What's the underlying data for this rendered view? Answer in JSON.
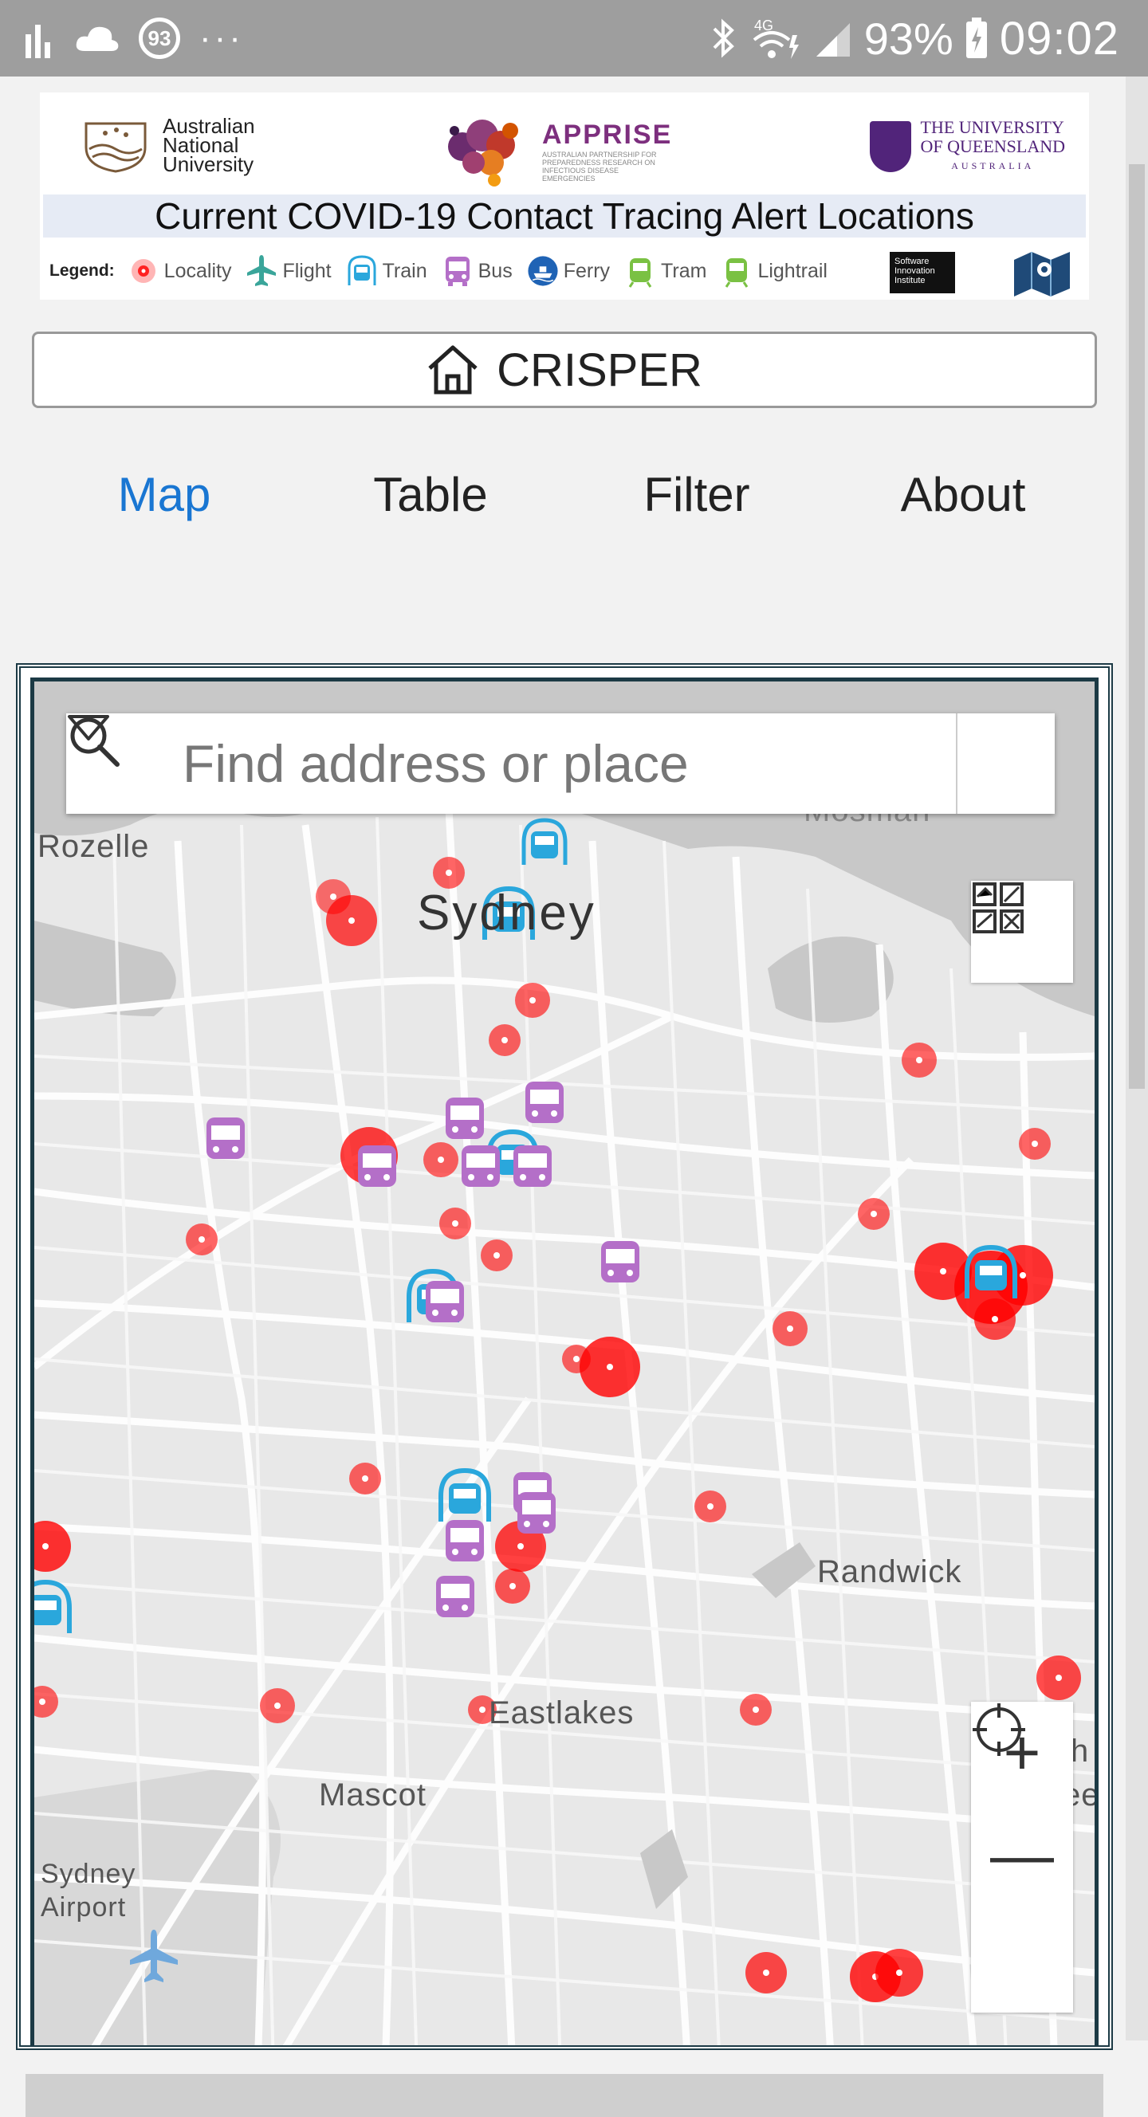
{
  "status_bar": {
    "notification_badge": "93",
    "more": "···",
    "battery": "93%",
    "time": "09:02",
    "network": "4G"
  },
  "banner": {
    "anu_name": "Australian National University",
    "apprise_name": "APPRISE",
    "apprise_subtitle": "AUSTRALIAN PARTNERSHIP FOR PREPAREDNESS RESEARCH ON INFECTIOUS DISEASE EMERGENCIES",
    "uq_name_line1": "THE UNIVERSITY",
    "uq_name_line2": "OF QUEENSLAND",
    "uq_country": "AUSTRALIA",
    "title": "Current COVID-19 Contact Tracing Alert Locations",
    "legend_label": "Legend:",
    "legend": [
      "Locality",
      "Flight",
      "Train",
      "Bus",
      "Ferry",
      "Tram",
      "Lightrail"
    ],
    "sii_text": "Software Innovation Institute"
  },
  "home": {
    "label": "CRISPER"
  },
  "tabs": [
    {
      "label": "Map",
      "active": true
    },
    {
      "label": "Table",
      "active": false
    },
    {
      "label": "Filter",
      "active": false
    },
    {
      "label": "About",
      "active": false
    }
  ],
  "map": {
    "search_placeholder": "Find address or place",
    "labels": {
      "sydney": "Sydney",
      "rozelle": "Rozelle",
      "randwick": "Randwick",
      "eastlakes": "Eastlakes",
      "mascot": "Mascot",
      "airport_line1": "Sydney",
      "airport_line2": "Airport",
      "partial_top": "Mosman",
      "partial_right1": "h",
      "partial_right2": "ee"
    },
    "zoom_in": "+",
    "zoom_out": "—"
  },
  "colors": {
    "accent": "#1976d2",
    "locality": "#ff0000",
    "train": "#2aa7dc",
    "bus": "#b46fc8",
    "tram": "#7ac143",
    "ferry": "#1f63b5"
  }
}
